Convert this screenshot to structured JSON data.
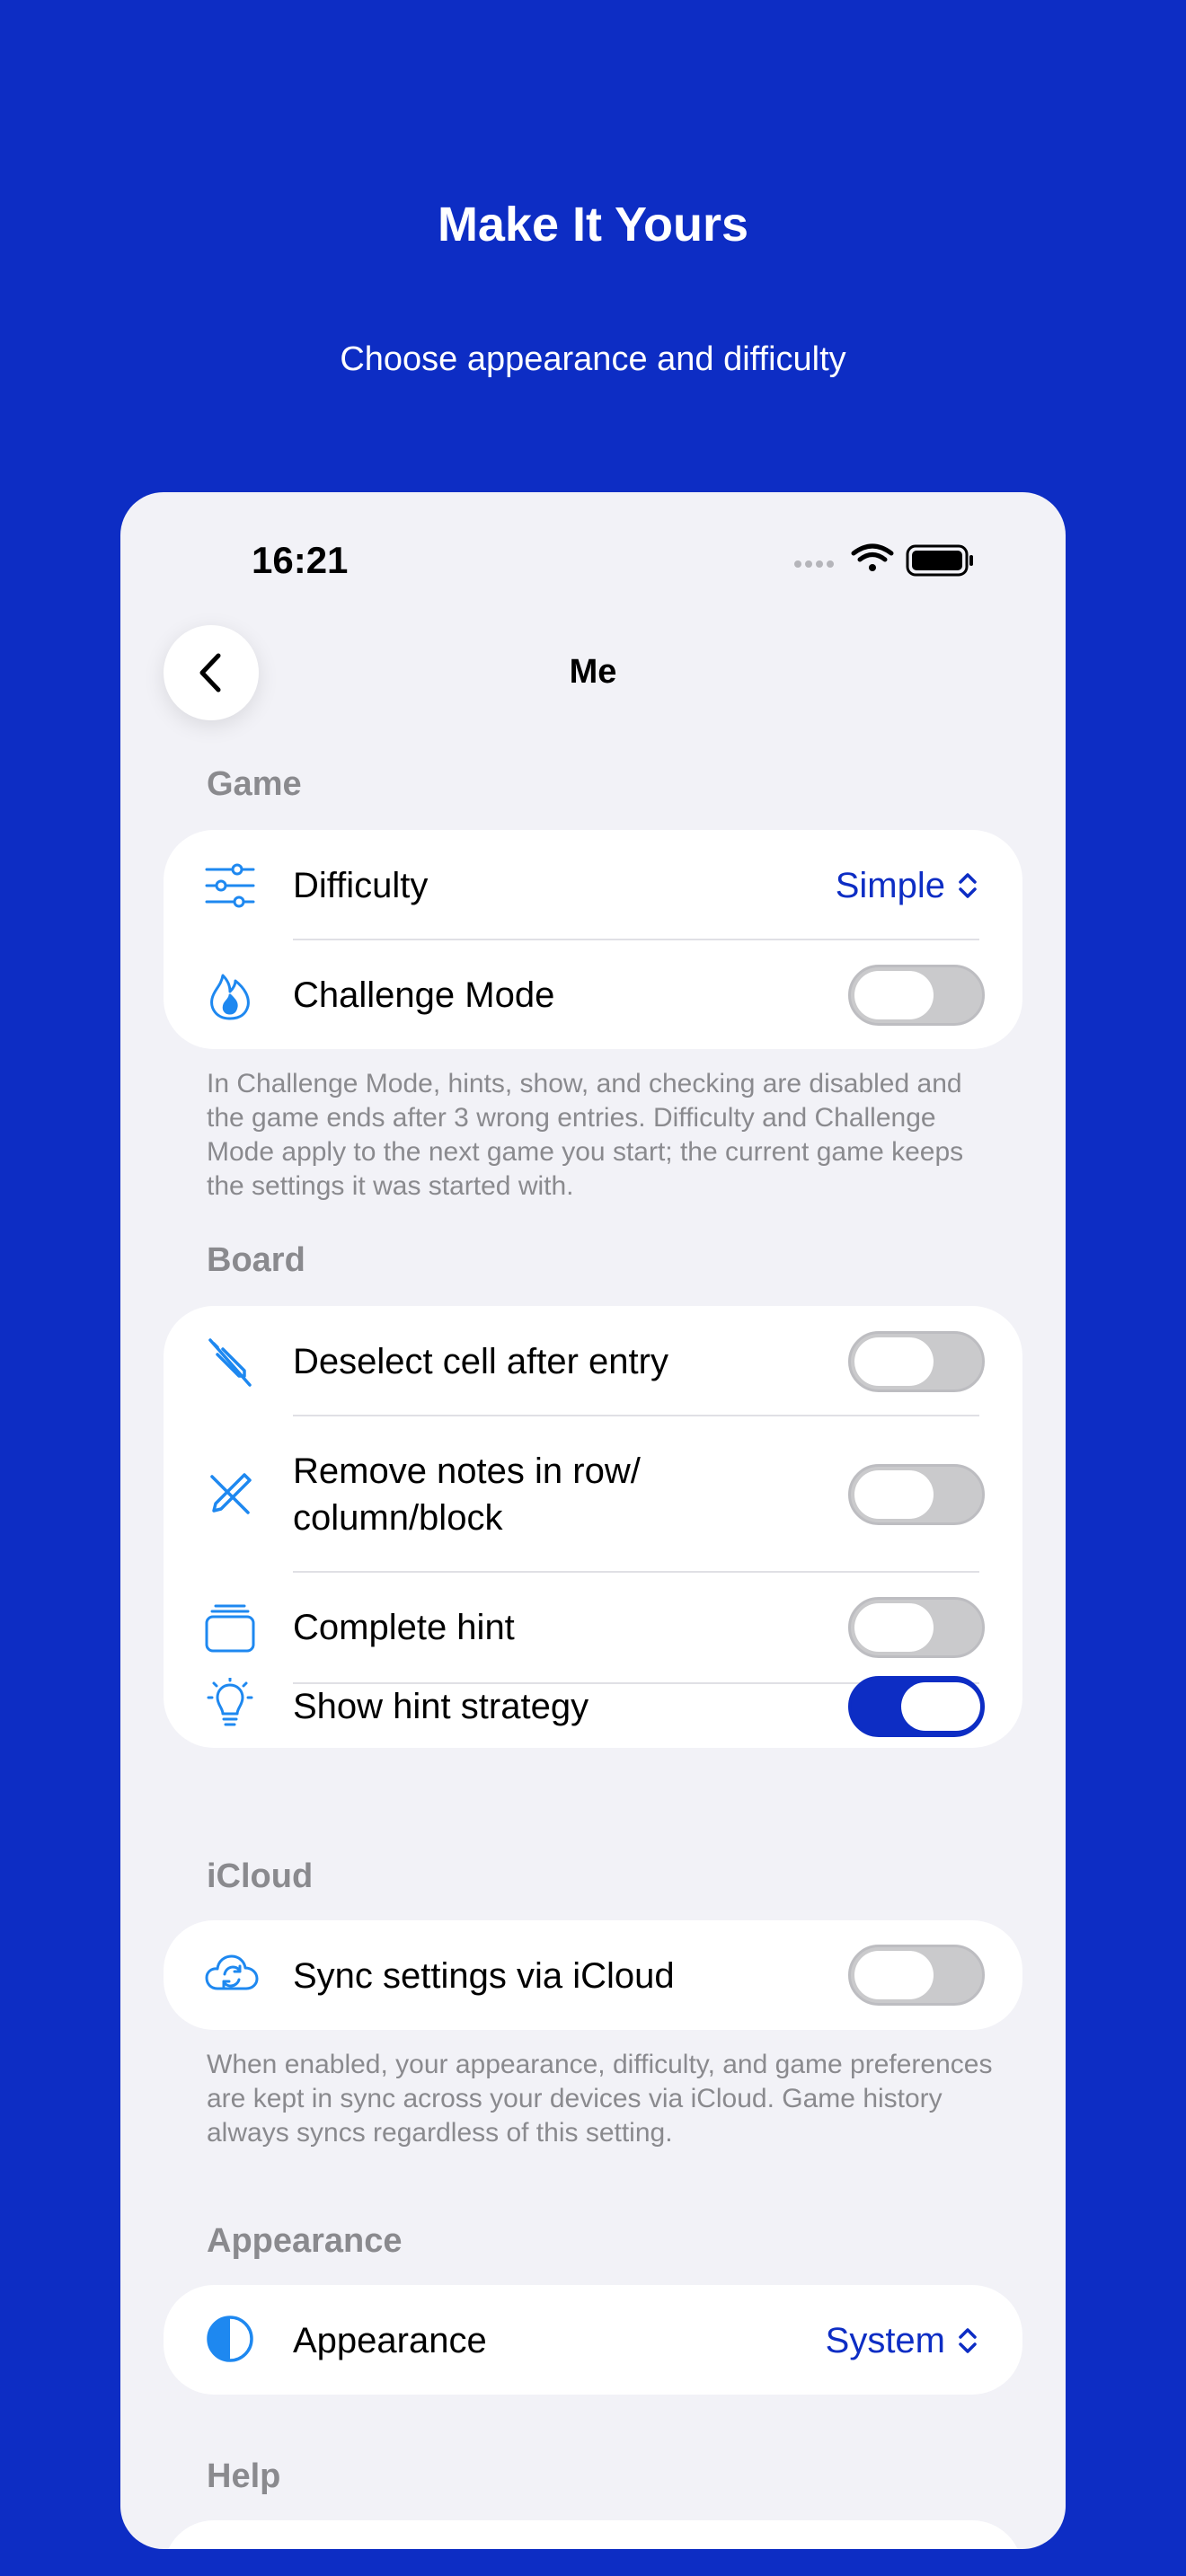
{
  "promo": {
    "title": "Make It Yours",
    "subtitle": "Choose appearance and difficulty"
  },
  "status_bar": {
    "time": "16:21"
  },
  "nav": {
    "title": "Me",
    "back_icon": "chevron-left-icon"
  },
  "colors": {
    "brand": "#0d2dc4",
    "icon": "#1e88f0",
    "background": "#f2f2f7",
    "secondary_text": "#8a8a8e"
  },
  "sections": {
    "game": {
      "header": "Game",
      "difficulty": {
        "label": "Difficulty",
        "value": "Simple",
        "icon": "sliders-icon"
      },
      "challenge_mode": {
        "label": "Challenge Mode",
        "on": false,
        "icon": "flame-icon"
      },
      "footnote": "In Challenge Mode, hints, show, and checking are disabled and the game ends after 3 wrong entries. Difficulty and Challenge Mode apply to the next game you start; the current game keeps the settings it was started with."
    },
    "board": {
      "header": "Board",
      "deselect": {
        "label": "Deselect cell after entry",
        "on": false,
        "icon": "deselect-pen-icon"
      },
      "remove_notes": {
        "label": "Remove notes in row/ column/block",
        "on": false,
        "icon": "pencil-slash-icon"
      },
      "complete_hint": {
        "label": "Complete hint",
        "on": false,
        "icon": "stack-icon"
      },
      "show_strategy": {
        "label": "Show hint strategy",
        "on": true,
        "icon": "lightbulb-icon"
      }
    },
    "icloud": {
      "header": "iCloud",
      "sync": {
        "label": "Sync settings via iCloud",
        "on": false,
        "icon": "icloud-sync-icon"
      },
      "footnote": "When enabled, your appearance, difficulty, and game preferences are kept in sync across your devices via iCloud. Game history always syncs regardless of this setting."
    },
    "appearance": {
      "header": "Appearance",
      "appearance": {
        "label": "Appearance",
        "value": "System",
        "icon": "half-circle-icon"
      }
    },
    "help": {
      "header": "Help"
    }
  }
}
